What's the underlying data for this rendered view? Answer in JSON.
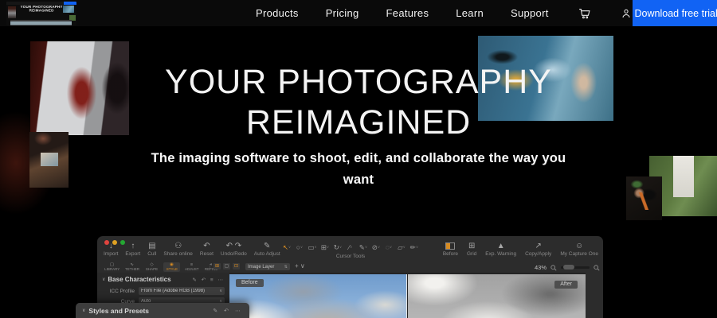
{
  "nav": {
    "links": [
      {
        "label": "Products"
      },
      {
        "label": "Pricing"
      },
      {
        "label": "Features"
      },
      {
        "label": "Learn"
      },
      {
        "label": "Support"
      }
    ],
    "cta": "Download free trial"
  },
  "hero": {
    "title_line1": "YOUR PHOTOGRAPHY",
    "title_line2": "REIMAGINED",
    "subtitle": "The imaging software to shoot, edit, and collaborate the way you want"
  },
  "app": {
    "toolbar_left": [
      {
        "label": "Import",
        "glyph": "↓"
      },
      {
        "label": "Export",
        "glyph": "↑"
      },
      {
        "label": "Cull",
        "glyph": "▤"
      },
      {
        "label": "Share online",
        "glyph": "⚇"
      },
      {
        "label": "Reset",
        "glyph": "↶"
      },
      {
        "label": "Undo/Redo",
        "glyph": "↶ ↷"
      },
      {
        "label": "Auto Adjust",
        "glyph": "✎"
      }
    ],
    "cursor_tools_label": "Cursor Tools",
    "cursor_tools": [
      "↖",
      "○",
      "▭",
      "⊞",
      "↻",
      "∕",
      "✎",
      "⊘",
      "◌",
      "▱",
      "✏"
    ],
    "toolbar_right": [
      {
        "label": "Before"
      },
      {
        "label": "Grid",
        "glyph": "⊞"
      },
      {
        "label": "Exp. Warning",
        "glyph": "▲"
      },
      {
        "label": "Copy/Apply",
        "glyph": "↗"
      },
      {
        "label": "My Capture One",
        "glyph": "☺"
      }
    ],
    "tabs": [
      {
        "label": "LIBRARY",
        "glyph": "▢"
      },
      {
        "label": "TETHER",
        "glyph": "∿"
      },
      {
        "label": "SHAPE",
        "glyph": "◇"
      },
      {
        "label": "STYLE",
        "glyph": "◉"
      },
      {
        "label": "ADJUST",
        "glyph": "≡"
      },
      {
        "label": "REFINE",
        "glyph": "◐"
      }
    ],
    "layer_select": "Image Layer",
    "add_layer": "+ ∨",
    "zoom_level": "43%",
    "panel": {
      "title": "Base Characteristics",
      "icc_label": "ICC Profile",
      "icc_value": "From File (Adobe RGB (1998)",
      "curve_label": "Curve",
      "curve_value": "Auto"
    },
    "floating_panel_title": "Styles and Presets",
    "viewer": {
      "before": "Before",
      "after": "After"
    }
  }
}
